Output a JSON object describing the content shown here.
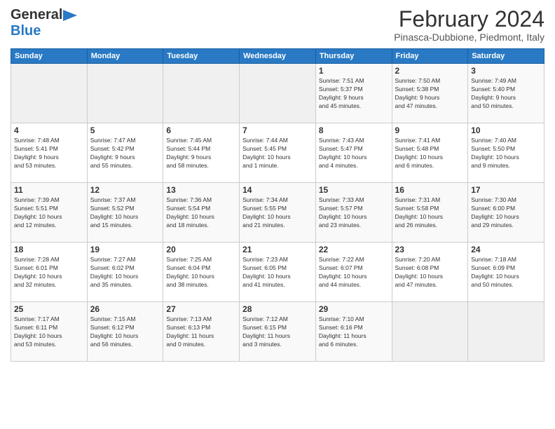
{
  "header": {
    "logo_general": "General",
    "logo_blue": "Blue",
    "month_title": "February 2024",
    "location": "Pinasca-Dubbione, Piedmont, Italy"
  },
  "days_of_week": [
    "Sunday",
    "Monday",
    "Tuesday",
    "Wednesday",
    "Thursday",
    "Friday",
    "Saturday"
  ],
  "weeks": [
    [
      {
        "day": "",
        "info": ""
      },
      {
        "day": "",
        "info": ""
      },
      {
        "day": "",
        "info": ""
      },
      {
        "day": "",
        "info": ""
      },
      {
        "day": "1",
        "info": "Sunrise: 7:51 AM\nSunset: 5:37 PM\nDaylight: 9 hours\nand 45 minutes."
      },
      {
        "day": "2",
        "info": "Sunrise: 7:50 AM\nSunset: 5:38 PM\nDaylight: 9 hours\nand 47 minutes."
      },
      {
        "day": "3",
        "info": "Sunrise: 7:49 AM\nSunset: 5:40 PM\nDaylight: 9 hours\nand 50 minutes."
      }
    ],
    [
      {
        "day": "4",
        "info": "Sunrise: 7:48 AM\nSunset: 5:41 PM\nDaylight: 9 hours\nand 53 minutes."
      },
      {
        "day": "5",
        "info": "Sunrise: 7:47 AM\nSunset: 5:42 PM\nDaylight: 9 hours\nand 55 minutes."
      },
      {
        "day": "6",
        "info": "Sunrise: 7:45 AM\nSunset: 5:44 PM\nDaylight: 9 hours\nand 58 minutes."
      },
      {
        "day": "7",
        "info": "Sunrise: 7:44 AM\nSunset: 5:45 PM\nDaylight: 10 hours\nand 1 minute."
      },
      {
        "day": "8",
        "info": "Sunrise: 7:43 AM\nSunset: 5:47 PM\nDaylight: 10 hours\nand 4 minutes."
      },
      {
        "day": "9",
        "info": "Sunrise: 7:41 AM\nSunset: 5:48 PM\nDaylight: 10 hours\nand 6 minutes."
      },
      {
        "day": "10",
        "info": "Sunrise: 7:40 AM\nSunset: 5:50 PM\nDaylight: 10 hours\nand 9 minutes."
      }
    ],
    [
      {
        "day": "11",
        "info": "Sunrise: 7:39 AM\nSunset: 5:51 PM\nDaylight: 10 hours\nand 12 minutes."
      },
      {
        "day": "12",
        "info": "Sunrise: 7:37 AM\nSunset: 5:52 PM\nDaylight: 10 hours\nand 15 minutes."
      },
      {
        "day": "13",
        "info": "Sunrise: 7:36 AM\nSunset: 5:54 PM\nDaylight: 10 hours\nand 18 minutes."
      },
      {
        "day": "14",
        "info": "Sunrise: 7:34 AM\nSunset: 5:55 PM\nDaylight: 10 hours\nand 21 minutes."
      },
      {
        "day": "15",
        "info": "Sunrise: 7:33 AM\nSunset: 5:57 PM\nDaylight: 10 hours\nand 23 minutes."
      },
      {
        "day": "16",
        "info": "Sunrise: 7:31 AM\nSunset: 5:58 PM\nDaylight: 10 hours\nand 26 minutes."
      },
      {
        "day": "17",
        "info": "Sunrise: 7:30 AM\nSunset: 6:00 PM\nDaylight: 10 hours\nand 29 minutes."
      }
    ],
    [
      {
        "day": "18",
        "info": "Sunrise: 7:28 AM\nSunset: 6:01 PM\nDaylight: 10 hours\nand 32 minutes."
      },
      {
        "day": "19",
        "info": "Sunrise: 7:27 AM\nSunset: 6:02 PM\nDaylight: 10 hours\nand 35 minutes."
      },
      {
        "day": "20",
        "info": "Sunrise: 7:25 AM\nSunset: 6:04 PM\nDaylight: 10 hours\nand 38 minutes."
      },
      {
        "day": "21",
        "info": "Sunrise: 7:23 AM\nSunset: 6:05 PM\nDaylight: 10 hours\nand 41 minutes."
      },
      {
        "day": "22",
        "info": "Sunrise: 7:22 AM\nSunset: 6:07 PM\nDaylight: 10 hours\nand 44 minutes."
      },
      {
        "day": "23",
        "info": "Sunrise: 7:20 AM\nSunset: 6:08 PM\nDaylight: 10 hours\nand 47 minutes."
      },
      {
        "day": "24",
        "info": "Sunrise: 7:18 AM\nSunset: 6:09 PM\nDaylight: 10 hours\nand 50 minutes."
      }
    ],
    [
      {
        "day": "25",
        "info": "Sunrise: 7:17 AM\nSunset: 6:11 PM\nDaylight: 10 hours\nand 53 minutes."
      },
      {
        "day": "26",
        "info": "Sunrise: 7:15 AM\nSunset: 6:12 PM\nDaylight: 10 hours\nand 56 minutes."
      },
      {
        "day": "27",
        "info": "Sunrise: 7:13 AM\nSunset: 6:13 PM\nDaylight: 11 hours\nand 0 minutes."
      },
      {
        "day": "28",
        "info": "Sunrise: 7:12 AM\nSunset: 6:15 PM\nDaylight: 11 hours\nand 3 minutes."
      },
      {
        "day": "29",
        "info": "Sunrise: 7:10 AM\nSunset: 6:16 PM\nDaylight: 11 hours\nand 6 minutes."
      },
      {
        "day": "",
        "info": ""
      },
      {
        "day": "",
        "info": ""
      }
    ]
  ]
}
